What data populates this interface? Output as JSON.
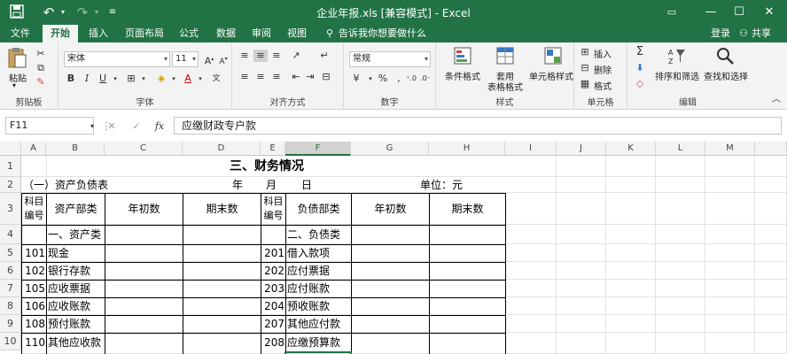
{
  "window": {
    "title": "企业年报.xls  [兼容模式] - Excel",
    "controls": {
      "restore_icon": "ribbon-display-icon",
      "minimize": "—",
      "maximize": "☐",
      "close": "✕"
    }
  },
  "quick_access": {
    "save": "save-icon",
    "undo": "undo-icon",
    "redo": "redo-icon",
    "customize": "customize-icon"
  },
  "tabs": [
    "文件",
    "开始",
    "插入",
    "页面布局",
    "公式",
    "数据",
    "审阅",
    "视图"
  ],
  "tell_me": "告诉我你想要做什么",
  "account": {
    "login": "登录",
    "share": "共享"
  },
  "ribbon": {
    "clipboard": {
      "paste": "粘贴",
      "label": "剪贴板"
    },
    "font": {
      "name": "宋体",
      "size": "11",
      "label": "字体",
      "bold": "B",
      "italic": "I",
      "underline": "U"
    },
    "alignment": {
      "label": "对齐方式"
    },
    "number": {
      "format": "常规",
      "label": "数字",
      "percent": "%",
      "comma": ","
    },
    "styles": {
      "conditional": "条件格式",
      "table_format_1": "套用",
      "table_format_2": "表格格式",
      "cell_styles": "单元格样式",
      "label": "样式"
    },
    "cells": {
      "insert": "插入",
      "delete": "删除",
      "format": "格式",
      "label": "单元格"
    },
    "editing": {
      "sort_filter": "排序和筛选",
      "find_select": "查找和选择",
      "label": "编辑"
    }
  },
  "formula_bar": {
    "name_box": "F11",
    "cancel": "✕",
    "enter": "✓",
    "fx": "fx",
    "content": "应缴财政专户款"
  },
  "columns": [
    "A",
    "B",
    "C",
    "D",
    "E",
    "F",
    "G",
    "H",
    "I",
    "J",
    "K",
    "L",
    "M"
  ],
  "rows": [
    "1",
    "2",
    "3",
    "4",
    "5",
    "6",
    "7",
    "8",
    "9",
    "10"
  ],
  "sheet": {
    "title": "三、财务情况",
    "row2": {
      "subtitle": "（一）资产负债表",
      "year": "年",
      "month": "月",
      "day": "日",
      "unit": "单位：元"
    },
    "header": {
      "code1": "科目",
      "code2": "编号",
      "asset": "资产部类",
      "begin": "年初数",
      "end": "期末数",
      "liab": "负债部类"
    },
    "row4": {
      "asset": "一、资产类",
      "liab": "二、负债类"
    },
    "data": [
      {
        "code": "101",
        "asset": "现金",
        "lcode": "201",
        "liab": "借入款项"
      },
      {
        "code": "102",
        "asset": "银行存款",
        "lcode": "202",
        "liab": "应付票据"
      },
      {
        "code": "105",
        "asset": "应收票据",
        "lcode": "203",
        "liab": "应付账款"
      },
      {
        "code": "106",
        "asset": "应收账款",
        "lcode": "204",
        "liab": "预收账款"
      },
      {
        "code": "108",
        "asset": "预付账款",
        "lcode": "207",
        "liab": "其他应付款"
      },
      {
        "code": "110",
        "asset": "其他应收款",
        "lcode": "208",
        "liab": "应缴预算款"
      }
    ]
  },
  "colors": {
    "accent": "#217346",
    "header_bg": "#f3f3f3"
  }
}
